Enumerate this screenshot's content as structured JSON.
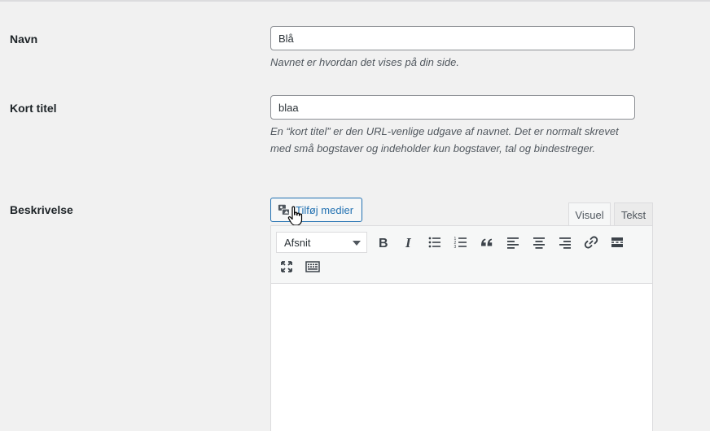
{
  "fields": {
    "name": {
      "label": "Navn",
      "value": "Blå",
      "description": "Navnet er hvordan det vises på din side."
    },
    "slug": {
      "label": "Kort titel",
      "value": "blaa",
      "description": "En “kort titel” er den URL-venlige udgave af navnet. Det er normalt skrevet med små bogstaver og indeholder kun bogstaver, tal og bindestreger."
    },
    "description": {
      "label": "Beskrivelse"
    }
  },
  "editor": {
    "add_media_label": "Tilføj medier",
    "tabs": [
      {
        "label": "Visuel",
        "active": true
      },
      {
        "label": "Tekst",
        "active": false
      }
    ],
    "format_select": "Afsnit",
    "toolbar_icons": [
      "bold-icon",
      "italic-icon",
      "bulleted-list-icon",
      "numbered-list-icon",
      "blockquote-icon",
      "align-left-icon",
      "align-center-icon",
      "align-right-icon",
      "link-icon",
      "read-more-icon",
      "fullscreen-icon",
      "toolbar-toggle-icon"
    ],
    "content": ""
  },
  "colors": {
    "accent": "#2271b1",
    "background": "#f1f1f1"
  }
}
